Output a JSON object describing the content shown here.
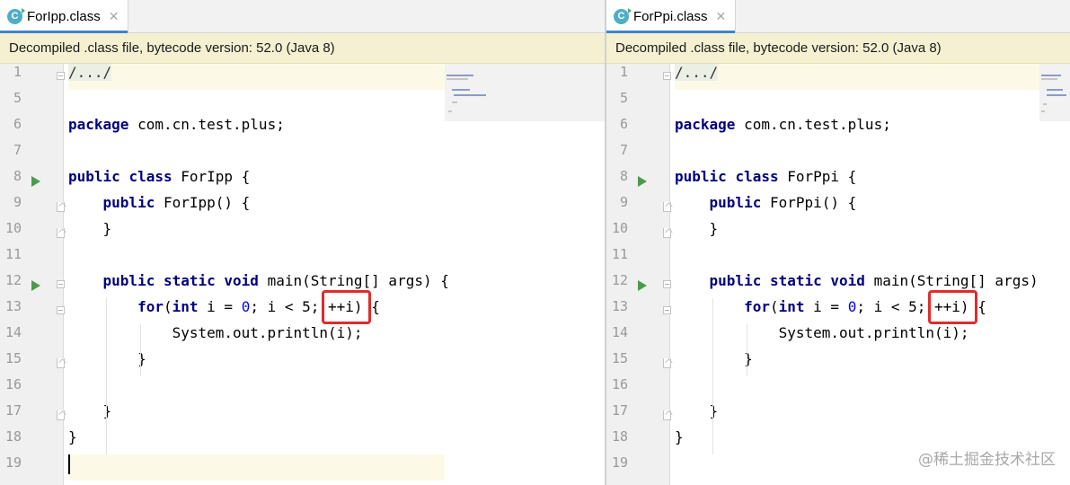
{
  "left": {
    "tab": {
      "icon": "class-file-icon",
      "icon_letter": "C",
      "label": "ForIpp.class",
      "close": "✕"
    },
    "banner": "Decompiled .class file, bytecode version: 52.0 (Java 8)",
    "lines": [
      {
        "n": "1",
        "text": "/.../"
      },
      {
        "n": "5",
        "text": ""
      },
      {
        "n": "6",
        "text": "package com.cn.test.plus;"
      },
      {
        "n": "7",
        "text": ""
      },
      {
        "n": "8",
        "text": "public class ForIpp {"
      },
      {
        "n": "9",
        "text": "    public ForIpp() {"
      },
      {
        "n": "10",
        "text": "    }"
      },
      {
        "n": "11",
        "text": ""
      },
      {
        "n": "12",
        "text": "    public static void main(String[] args) {"
      },
      {
        "n": "13",
        "text": "        for(int i = 0; i < 5; ++i) {"
      },
      {
        "n": "14",
        "text": "            System.out.println(i);"
      },
      {
        "n": "15",
        "text": "        }"
      },
      {
        "n": "16",
        "text": ""
      },
      {
        "n": "17",
        "text": "    }"
      },
      {
        "n": "18",
        "text": "}"
      },
      {
        "n": "19",
        "text": ""
      }
    ]
  },
  "right": {
    "tab": {
      "icon": "class-file-icon",
      "icon_letter": "C",
      "label": "ForPpi.class",
      "close": "✕"
    },
    "banner": "Decompiled .class file, bytecode version: 52.0 (Java 8)",
    "lines": [
      {
        "n": "1",
        "text": "/.../"
      },
      {
        "n": "5",
        "text": ""
      },
      {
        "n": "6",
        "text": "package com.cn.test.plus;"
      },
      {
        "n": "7",
        "text": ""
      },
      {
        "n": "8",
        "text": "public class ForPpi {"
      },
      {
        "n": "9",
        "text": "    public ForPpi() {"
      },
      {
        "n": "10",
        "text": "    }"
      },
      {
        "n": "11",
        "text": ""
      },
      {
        "n": "12",
        "text": "    public static void main(String[] args) {"
      },
      {
        "n": "13",
        "text": "        for(int i = 0; i < 5; ++i) {"
      },
      {
        "n": "14",
        "text": "            System.out.println(i);"
      },
      {
        "n": "15",
        "text": "        }"
      },
      {
        "n": "16",
        "text": ""
      },
      {
        "n": "17",
        "text": "    }"
      },
      {
        "n": "18",
        "text": "}"
      },
      {
        "n": "19",
        "text": ""
      }
    ]
  },
  "watermark": "@稀土掘金技术社区",
  "colors": {
    "keyword": "#000080",
    "number": "#0000ff",
    "banner_bg": "#f5f0d2",
    "highlight_box": "#e12b2b",
    "run_icon": "#4d9a4e"
  }
}
